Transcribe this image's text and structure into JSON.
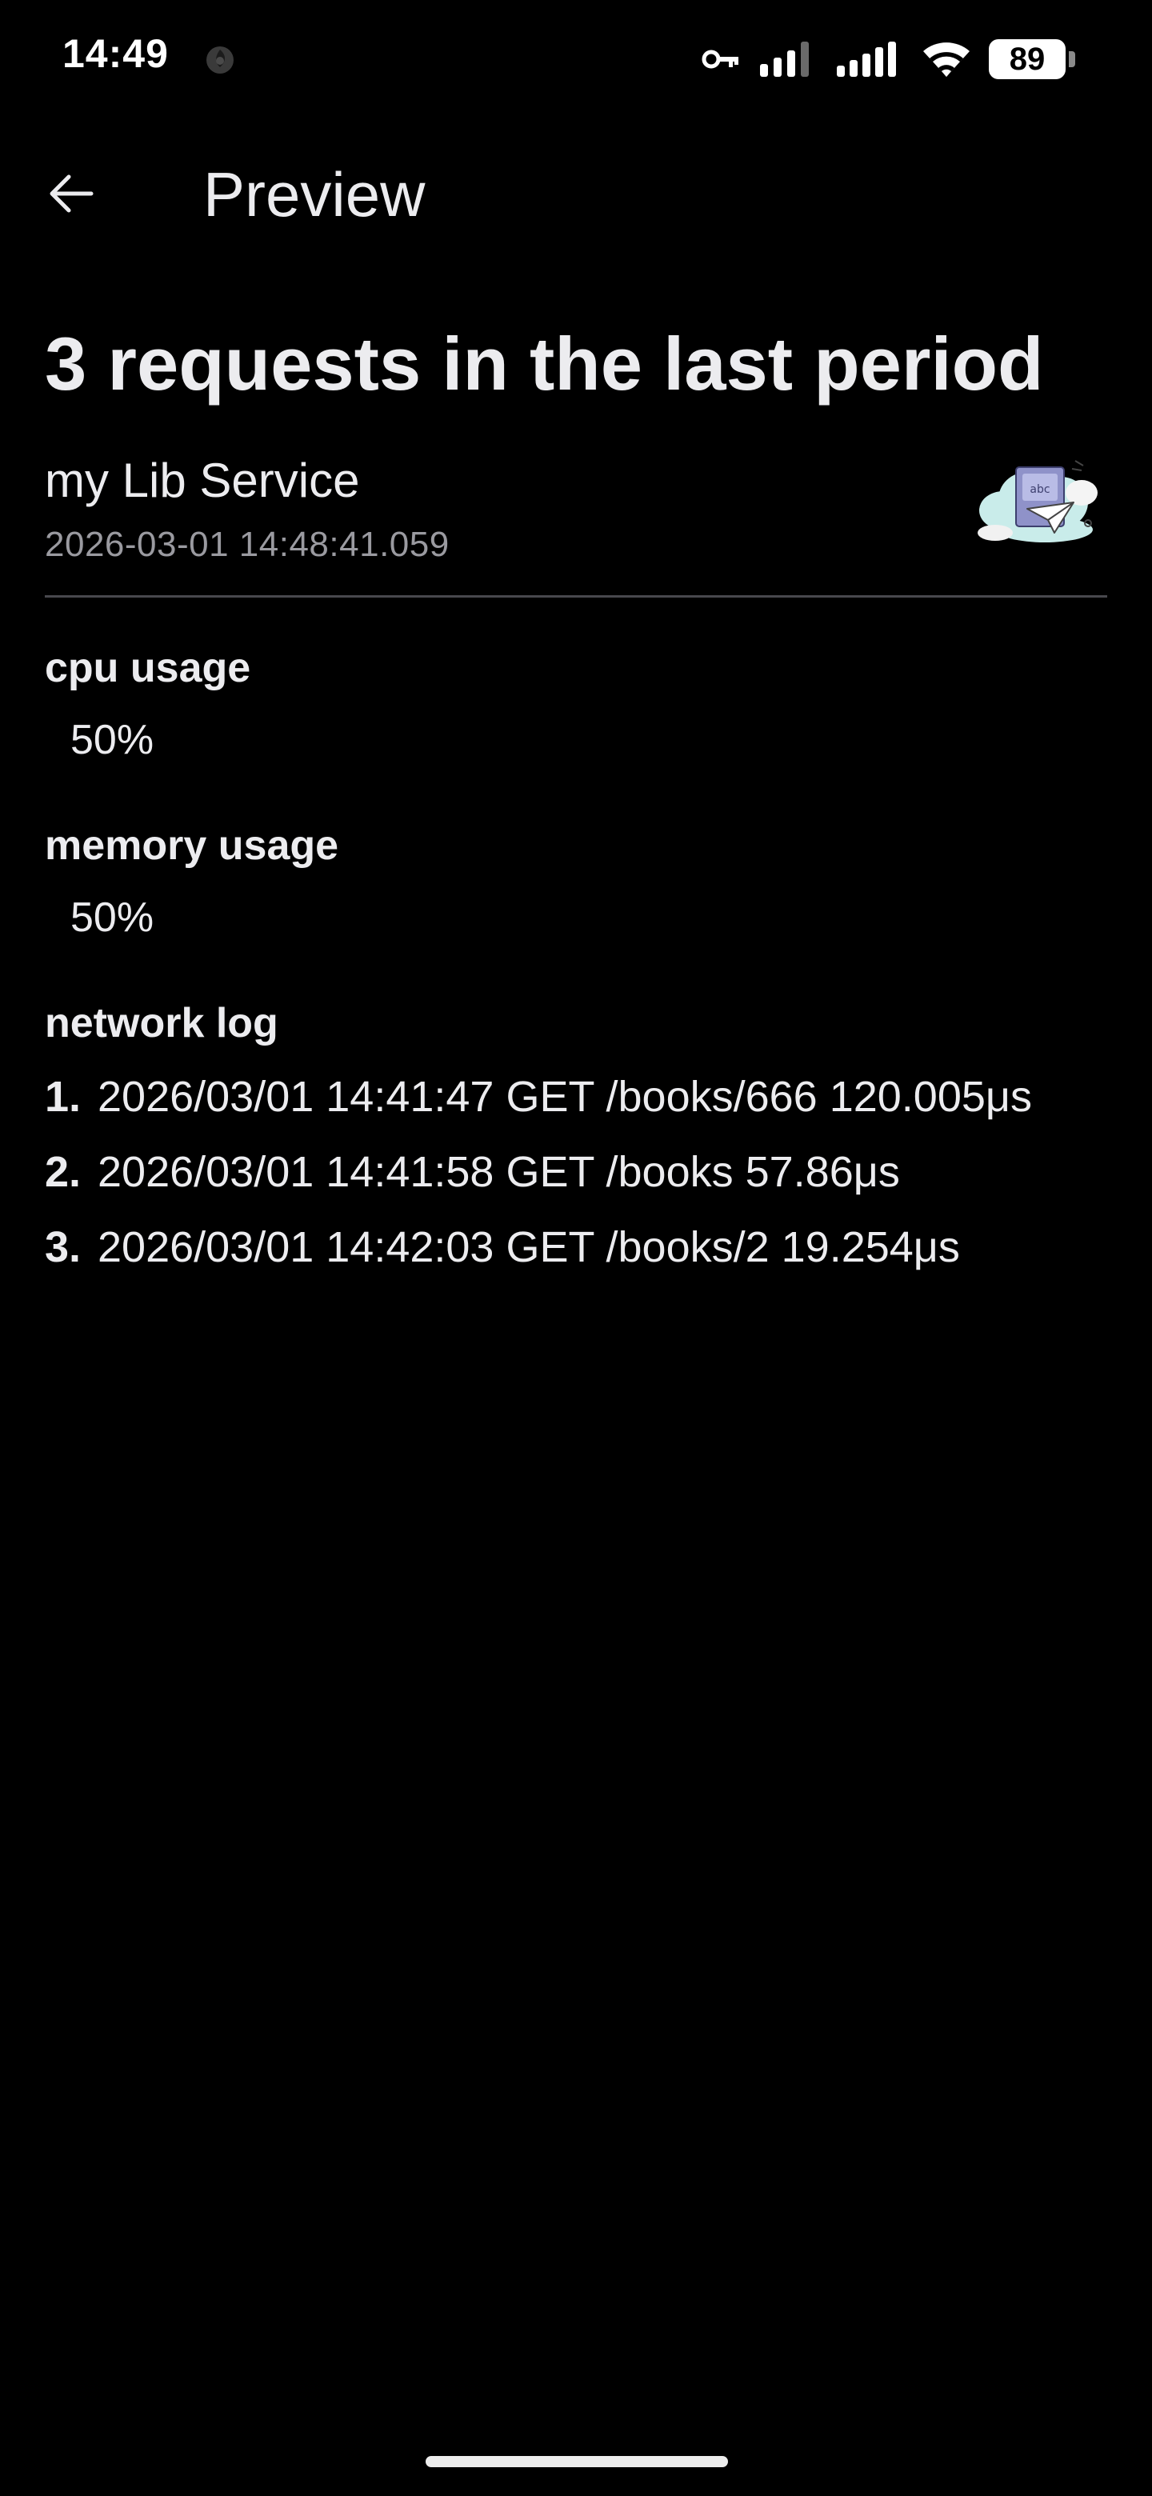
{
  "status_bar": {
    "time": "14:49",
    "battery": "89",
    "icons": [
      "notification-app-icon",
      "vpn-key-icon",
      "signal-sim1-icon",
      "signal-sim2-icon",
      "wifi-icon",
      "battery-icon"
    ]
  },
  "app_bar": {
    "title": "Preview",
    "back_icon": "arrow-back-icon"
  },
  "main": {
    "heading": "3 requests in the last period",
    "service": {
      "name": "my Lib Service",
      "timestamp": "2026-03-01 14:48:41.059",
      "avatar_icon": "service-avatar-icon"
    },
    "cpu": {
      "label": "cpu usage",
      "value": "50%"
    },
    "memory": {
      "label": "memory usage",
      "value": "50%"
    },
    "network_log": {
      "label": "network log",
      "entries": [
        {
          "num": "1.",
          "text": "2026/03/01 14:41:47 GET /books/666 120.005μs"
        },
        {
          "num": "2.",
          "text": "2026/03/01 14:41:58 GET /books 57.86μs"
        },
        {
          "num": "3.",
          "text": "2026/03/01 14:42:03 GET /books/2 19.254μs"
        }
      ]
    }
  },
  "colors": {
    "background": "#000000",
    "text_primary": "#ececef",
    "text_secondary": "#9a9aa0",
    "divider": "#48484d"
  }
}
